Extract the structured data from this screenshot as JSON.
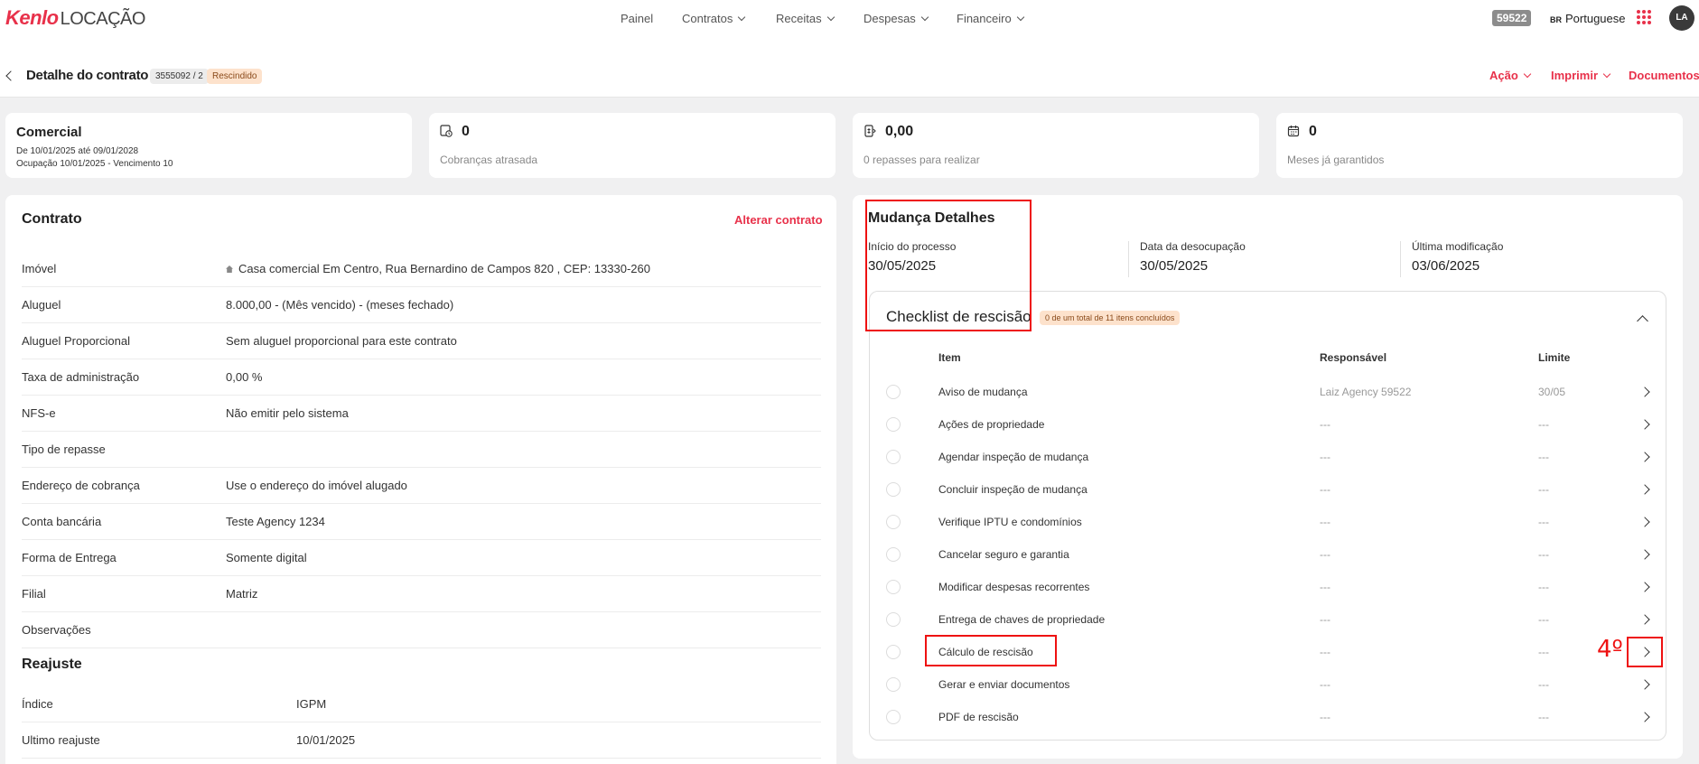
{
  "brand": {
    "name": "Kenlo",
    "product": "LOCAÇÃO"
  },
  "nav": [
    {
      "label": "Painel",
      "dropdown": false
    },
    {
      "label": "Contratos",
      "dropdown": true
    },
    {
      "label": "Receitas",
      "dropdown": true
    },
    {
      "label": "Despesas",
      "dropdown": true
    },
    {
      "label": "Financeiro",
      "dropdown": true
    }
  ],
  "user": {
    "agency_badge": "59522",
    "lang_flag": "BR",
    "language": "Portuguese",
    "initials": "LA"
  },
  "header": {
    "title": "Detalhe do contrato",
    "contract_id": "3555092 / 2",
    "status": "Rescindido",
    "actions": [
      "Ação",
      "Imprimir",
      "Documentos"
    ]
  },
  "summary": {
    "type": "Comercial",
    "period": "De 10/01/2025 até 09/01/2028",
    "occupation": "Ocupação 10/01/2025 - Vencimento 10",
    "stats": [
      {
        "icon": "clock-billing-icon",
        "value": "0",
        "label": "Cobranças atrasada"
      },
      {
        "icon": "money-transfer-icon",
        "value": "0,00",
        "label": "0 repasses para realizar"
      },
      {
        "icon": "calendar-icon",
        "value": "0",
        "label": "Meses já garantidos"
      }
    ]
  },
  "contract": {
    "title": "Contrato",
    "edit_label": "Alterar contrato",
    "rows": [
      {
        "label": "Imóvel",
        "value": "Casa comercial Em Centro, Rua Bernardino de Campos 820 , CEP: 13330-260",
        "home": true
      },
      {
        "label": "Aluguel",
        "value": "8.000,00 - (Mês vencido) - (meses fechado)"
      },
      {
        "label": "Aluguel Proporcional",
        "value": "Sem aluguel proporcional para este contrato"
      },
      {
        "label": "Taxa de administração",
        "value": "0,00 %"
      },
      {
        "label": "NFS-e",
        "value": "Não emitir pelo sistema"
      },
      {
        "label": "Tipo de repasse",
        "value": ""
      },
      {
        "label": "Endereço de cobrança",
        "value": "Use o endereço do imóvel alugado"
      },
      {
        "label": "Conta bancária",
        "value": "Teste Agency 1234"
      },
      {
        "label": "Forma de Entrega",
        "value": "Somente digital"
      },
      {
        "label": "Filial",
        "value": "Matriz"
      },
      {
        "label": "Observações",
        "value": ""
      }
    ],
    "readjust_title": "Reajuste",
    "readjust_rows": [
      {
        "label": "Índice",
        "value": "IGPM"
      },
      {
        "label": "Ultimo reajuste",
        "value": "10/01/2025"
      }
    ]
  },
  "move": {
    "title": "Mudança Detalhes",
    "details": [
      {
        "label": "Início do processo",
        "value": "30/05/2025"
      },
      {
        "label": "Data da desocupação",
        "value": "30/05/2025"
      },
      {
        "label": "Última modificação",
        "value": "03/06/2025"
      }
    ]
  },
  "checklist": {
    "title": "Checklist de rescisão",
    "progress": "0 de um total de 11 itens concluídos",
    "headers": {
      "item": "Item",
      "responsible": "Responsável",
      "limit": "Limite"
    },
    "items": [
      {
        "item": "Aviso de mudança",
        "responsible": "Laiz Agency 59522",
        "limit": "30/05"
      },
      {
        "item": "Ações de propriedade",
        "responsible": "---",
        "limit": "---"
      },
      {
        "item": "Agendar inspeção de mudança",
        "responsible": "---",
        "limit": "---"
      },
      {
        "item": "Concluir inspeção de mudança",
        "responsible": "---",
        "limit": "---"
      },
      {
        "item": "Verifique IPTU e condomínios",
        "responsible": "---",
        "limit": "---"
      },
      {
        "item": "Cancelar seguro e garantia",
        "responsible": "---",
        "limit": "---"
      },
      {
        "item": "Modificar despesas recorrentes",
        "responsible": "---",
        "limit": "---"
      },
      {
        "item": "Entrega de chaves de propriedade",
        "responsible": "---",
        "limit": "---"
      },
      {
        "item": "Cálculo de rescisão",
        "responsible": "---",
        "limit": "---"
      },
      {
        "item": "Gerar e enviar documentos",
        "responsible": "---",
        "limit": "---"
      },
      {
        "item": "PDF de rescisão",
        "responsible": "---",
        "limit": "---"
      }
    ]
  },
  "annotation": {
    "step": "4º"
  }
}
